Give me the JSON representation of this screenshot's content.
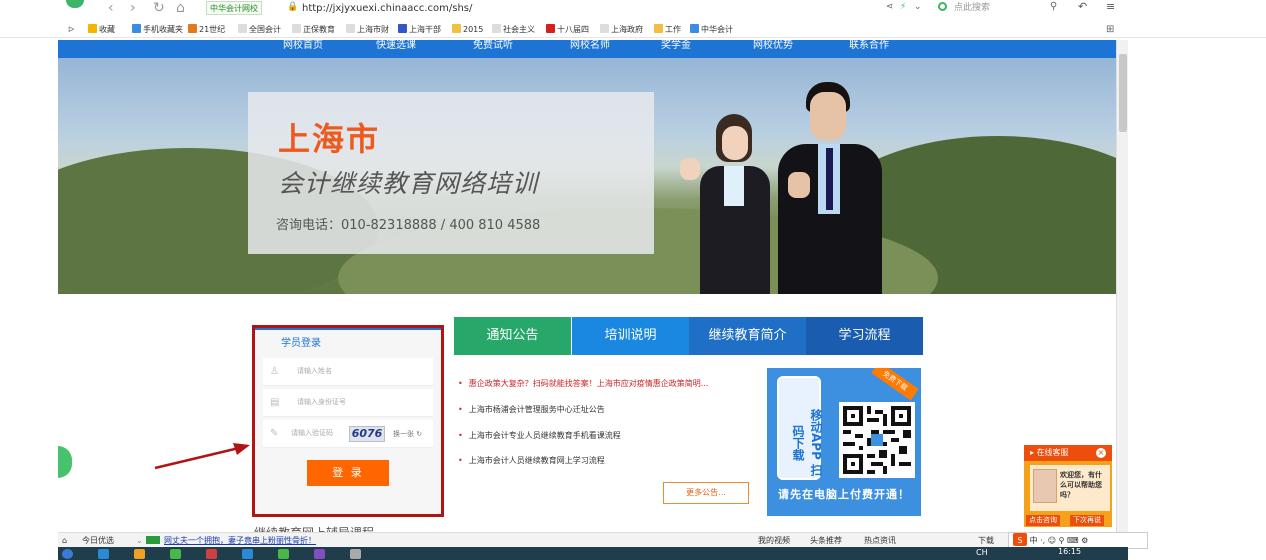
{
  "browser": {
    "site_chip": "中华会计网校",
    "url": "http://jxjyxuexi.chinaacc.com/shs/",
    "search_placeholder": "点此搜索",
    "bookmarks": [
      {
        "label": "收藏",
        "color": "#f5b400"
      },
      {
        "label": "手机收藏夹",
        "color": "#3b8de0"
      },
      {
        "label": "21世纪",
        "color": "#e27a1c"
      },
      {
        "label": "全国会计",
        "color": "#bfbfbf"
      },
      {
        "label": "正保教育",
        "color": "#bfbfbf"
      },
      {
        "label": "上海市财",
        "color": "#bfbfbf"
      },
      {
        "label": "上海干部",
        "color": "#3157c9"
      },
      {
        "label": "2015",
        "color": "#f0c040"
      },
      {
        "label": "社会主义",
        "color": "#bfbfbf"
      },
      {
        "label": "十八届四",
        "color": "#d62020"
      },
      {
        "label": "上海政府",
        "color": "#bfbfbf"
      },
      {
        "label": "工作",
        "color": "#f0c040"
      },
      {
        "label": "中华会计",
        "color": "#3b8de0"
      }
    ]
  },
  "nav": {
    "items": [
      "网校首页",
      "快速选课",
      "免费试听",
      "网校名师",
      "奖学金",
      "网校优势",
      "联系合作"
    ]
  },
  "banner": {
    "city": "上海市",
    "title": "会计继续教育网络培训",
    "phone": "咨询电话：010-82318888 / 400 810 4588"
  },
  "login": {
    "title": "学员登录",
    "name_placeholder": "请输入姓名",
    "id_placeholder": "请输入身份证号",
    "code_placeholder": "请输入验证码",
    "captcha": "6076",
    "refresh": "换一张",
    "submit": "登 录"
  },
  "tabs": [
    {
      "label": "通知公告",
      "color": "#27a86a"
    },
    {
      "label": "培训说明",
      "color": "#1a88e0"
    },
    {
      "label": "继续教育简介",
      "color": "#1f6fc7"
    },
    {
      "label": "学习流程",
      "color": "#1a5cb0"
    }
  ],
  "notices": [
    {
      "text": "惠企政策大复杂？扫码就能找答案！上海市应对疫情惠企政策简明...",
      "highlight": true
    },
    {
      "text": "上海市杨浦会计管理服务中心迁址公告",
      "highlight": false
    },
    {
      "text": "上海市会计专业人员继续教育手机看课流程",
      "highlight": false
    },
    {
      "text": "上海市会计人员继续教育网上学习流程",
      "highlight": false
    }
  ],
  "more": "更多公告...",
  "app_promo": {
    "app_text": "移动APP 扫码下载",
    "ribbon": "免费下载",
    "caption": "请先在电脑上付费开通！"
  },
  "kefu": {
    "title": "在线客服",
    "message": "欢迎您，有什么可以帮助您吗？",
    "consult": "点击咨询",
    "later": "下次再说"
  },
  "partial_heading": "继续教育网上辅导课程",
  "statusbar": {
    "left": "今日优选",
    "news": "网丈夫一个拥抱，妻子竟串上粉丽性骨折！",
    "items": [
      "我的视频",
      "头条推荐",
      "热点资讯",
      "下载"
    ]
  },
  "taskbar": {
    "lang": "CH",
    "time": "16:15"
  }
}
